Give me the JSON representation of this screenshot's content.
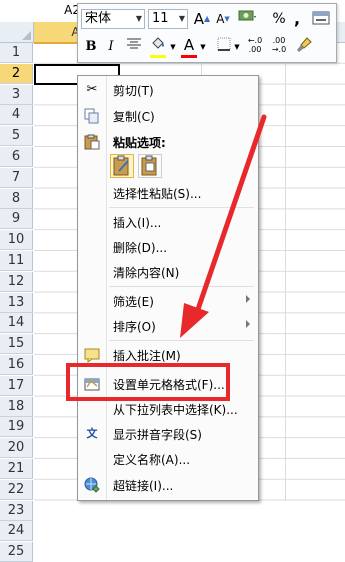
{
  "namebox": {
    "value": "A2"
  },
  "columns": [
    {
      "label": "A",
      "selected": true
    }
  ],
  "rows": [
    "1",
    "2",
    "3",
    "4",
    "5",
    "6",
    "7",
    "8",
    "9",
    "10",
    "11",
    "12",
    "13",
    "14",
    "15",
    "16",
    "17",
    "18",
    "19",
    "20",
    "21",
    "22",
    "23",
    "24",
    "25"
  ],
  "selected_row": "2",
  "mini_toolbar": {
    "font_name": "宋体",
    "font_size": "11",
    "grow_font": "A",
    "shrink_font": "A",
    "percent": "%",
    "comma": ",",
    "bold": "B",
    "italic": "I",
    "font_color_glyph": "A",
    "decimal_increase": "←.0 .00",
    "decimal_decrease": ".00 →.0",
    "accent_colors": {
      "fill": "#ffff00",
      "font": "#ff0000"
    }
  },
  "context_menu": {
    "items": [
      {
        "label": "剪切(T)",
        "icon": "scissors-icon"
      },
      {
        "label": "复制(C)",
        "icon": "copy-icon"
      },
      {
        "label": "粘贴选项:",
        "icon": "paste-icon"
      },
      {
        "label": "选择性粘贴(S)...",
        "icon": ""
      },
      {
        "label": "插入(I)...",
        "icon": ""
      },
      {
        "label": "删除(D)...",
        "icon": ""
      },
      {
        "label": "清除内容(N)",
        "icon": ""
      },
      {
        "label": "筛选(E)",
        "icon": "",
        "submenu": true
      },
      {
        "label": "排序(O)",
        "icon": "",
        "submenu": true
      },
      {
        "label": "插入批注(M)",
        "icon": "comment-icon"
      },
      {
        "label": "设置单元格格式(F)...",
        "icon": "format-cells-icon"
      },
      {
        "label": "从下拉列表中选择(K)...",
        "icon": ""
      },
      {
        "label": "显示拼音字段(S)",
        "icon": "phonetic-icon"
      },
      {
        "label": "定义名称(A)...",
        "icon": ""
      },
      {
        "label": "超链接(I)...",
        "icon": "hyperlink-icon"
      }
    ]
  },
  "annotation": {
    "highlight_color": "#e8292b"
  }
}
